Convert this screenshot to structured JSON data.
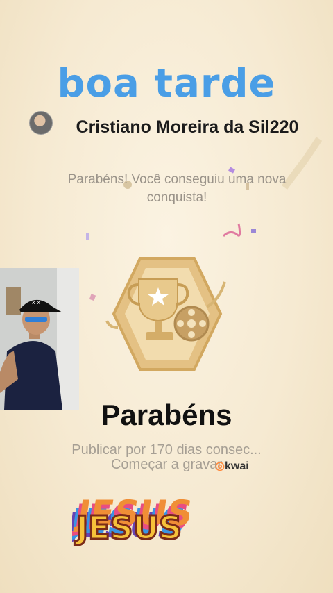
{
  "greeting": "boa tarde",
  "user": {
    "name": "Cristiano Moreira da Sil220",
    "avatar_icon": "user-avatar"
  },
  "message": "Parabéns! Você conseguiu uma nova conquista!",
  "achievement": {
    "title": "Parabéns",
    "description": "Publicar por 170 dias consec...",
    "action": "Começar a gravar",
    "badge_icon": "trophy-film-badge"
  },
  "watermark": "kwai",
  "sticker_text": "JESUS",
  "colors": {
    "greeting": "#4a9ee6",
    "badge_gold": "#e1bd7e",
    "background": "#f6ead2"
  }
}
